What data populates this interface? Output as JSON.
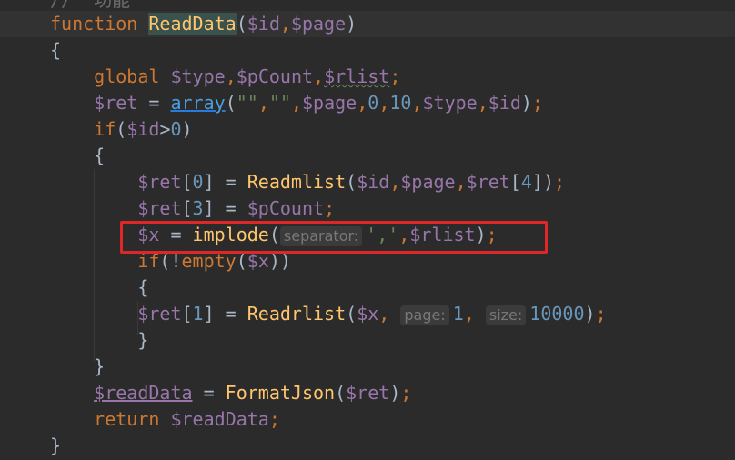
{
  "comment_top": "//  功能",
  "code": {
    "l1": {
      "kw": "function ",
      "name": "ReadData",
      "p1": "(",
      "v1": "$id",
      "c1": ",",
      "v2": "$page",
      "p2": ")"
    },
    "l2": "{",
    "l3": {
      "kw": "global ",
      "v1": "$type",
      "c1": ",",
      "v2": "$pCount",
      "c2": ",",
      "v3": "$rlist",
      "semi": ";"
    },
    "l4": {
      "v1": "$ret",
      "eq": " = ",
      "fn": "array",
      "p1": "(",
      "s1": "\"\"",
      "c1": ",",
      "s2": "\"\"",
      "c2": ",",
      "v2": "$page",
      "c3": ",",
      "n1": "0",
      "c4": ",",
      "n2": "10",
      "c5": ",",
      "v3": "$type",
      "c6": ",",
      "v4": "$id",
      "p2": ")",
      "semi": ";"
    },
    "l5": {
      "kw": "if",
      "p1": "(",
      "v1": "$id",
      "op": ">",
      "n1": "0",
      "p2": ")"
    },
    "l6": "{",
    "l7": {
      "v1": "$ret",
      "b1": "[",
      "n1": "0",
      "b2": "]",
      "eq": " = ",
      "fn": "Readmlist",
      "p1": "(",
      "v2": "$id",
      "c1": ",",
      "v3": "$page",
      "c2": ",",
      "v4": "$ret",
      "b3": "[",
      "n2": "4",
      "b4": "]",
      "p2": ")",
      "semi": ";"
    },
    "l8": {
      "v1": "$ret",
      "b1": "[",
      "n1": "3",
      "b2": "]",
      "eq": " = ",
      "v2": "$pCount",
      "semi": ";"
    },
    "l9": {
      "v1": "$x",
      "eq": " = ",
      "fn": "implode",
      "p1": "(",
      "hint": "separator:",
      "s1": "','",
      "c1": ",",
      "v2": "$rlist",
      "p2": ")",
      "semi": ";"
    },
    "l10": {
      "kw": "if",
      "p1": "(!",
      "fn": "empty",
      "p2": "(",
      "v1": "$x",
      "p3": "))"
    },
    "l11": "{",
    "l12": {
      "v1": "$ret",
      "b1": "[",
      "n1": "1",
      "b2": "]",
      "eq": " = ",
      "fn": "Readrlist",
      "p1": "(",
      "v2": "$x",
      "c1": ",",
      "hint1": "page:",
      "n2": "1",
      "c2": ",",
      "hint2": "size:",
      "n3": "10000",
      "p2": ")",
      "semi": ";"
    },
    "l13": "}",
    "l14": "}",
    "l15": {
      "v1": "$readData",
      "eq": " = ",
      "fn": "FormatJson",
      "p1": "(",
      "v2": "$ret",
      "p2": ")",
      "semi": ";"
    },
    "l16": {
      "kw": "return ",
      "v1": "$readData",
      "semi": ";"
    },
    "l17": "}"
  },
  "colors": {
    "background": "#2b2b2b",
    "keyword": "#cc7832",
    "function": "#ffc66d",
    "variable": "#9876aa",
    "string": "#6a8759",
    "number": "#6897bb",
    "highlight_box": "#e02626"
  }
}
